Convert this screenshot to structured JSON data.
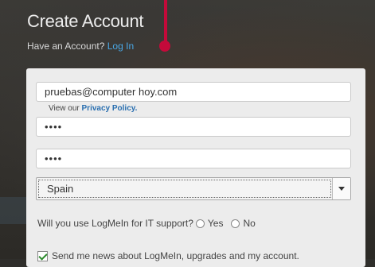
{
  "header": {
    "title": "Create Account",
    "subtitle_prefix": "Have an Account?",
    "login_link": "Log In"
  },
  "form": {
    "email_value": "pruebas@computer hoy.com",
    "privacy_prefix": "View our",
    "privacy_link": "Privacy Policy.",
    "password_value": "••••",
    "confirm_password_value": "••••",
    "country_selected": "Spain",
    "it_support_question": "Will you use LogMeIn for IT support?",
    "option_yes": "Yes",
    "option_no": "No",
    "newsletter_label": "Send me news about LogMeIn, upgrades and my account."
  },
  "colors": {
    "annotation": "#c40a3a",
    "link": "#4aa8e6"
  }
}
